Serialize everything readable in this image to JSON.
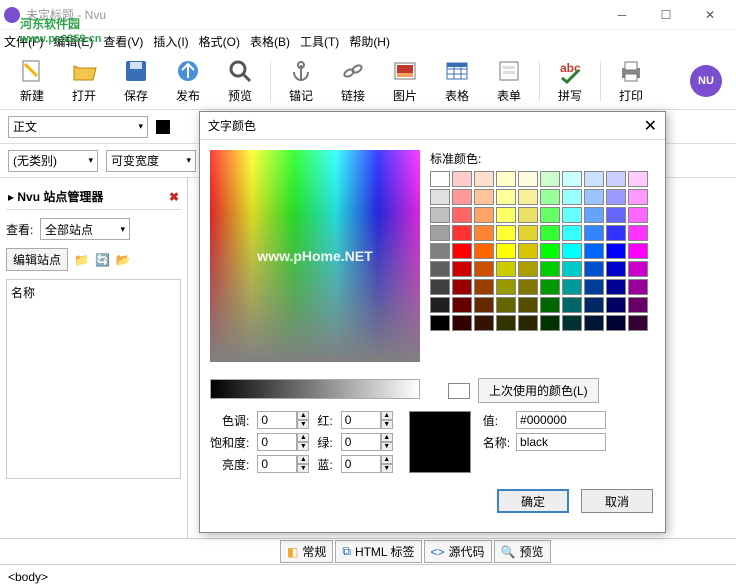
{
  "window": {
    "title": "未定标题 - Nvu"
  },
  "watermark": {
    "main": "河东软件园",
    "sub": "www.pc0359.cn"
  },
  "menu": {
    "file": "文件(F)",
    "edit": "编辑(E)",
    "view": "查看(V)",
    "insert": "插入(I)",
    "format": "格式(O)",
    "table": "表格(B)",
    "tools": "工具(T)",
    "help": "帮助(H)"
  },
  "toolbar": {
    "new": "新建",
    "open": "打开",
    "save": "保存",
    "publish": "发布",
    "preview": "预览",
    "anchor": "锚记",
    "link": "链接",
    "image": "图片",
    "table": "表格",
    "form": "表单",
    "spell": "拼写",
    "print": "打印"
  },
  "formatbar": {
    "style": "正文",
    "category": "(无类别)",
    "width": "可变宽度"
  },
  "sidepanel": {
    "title": "Nvu 站点管理器",
    "look": "查看:",
    "allsites": "全部站点",
    "editsite": "编辑站点",
    "name": "名称"
  },
  "tabs": {
    "normal": "常规",
    "htmltags": "HTML 标签",
    "source": "源代码",
    "preview": "预览"
  },
  "statusbar": {
    "path": "<body>"
  },
  "dialog": {
    "title": "文字颜色",
    "stdlabel": "标准颜色:",
    "lastused": "上次使用的颜色(L)",
    "hue": "色调:",
    "sat": "饱和度:",
    "lit": "亮度:",
    "red": "红:",
    "green": "绿:",
    "blue": "蓝:",
    "value": "值:",
    "name": "名称:",
    "hueV": "0",
    "satV": "0",
    "litV": "0",
    "redV": "0",
    "greenV": "0",
    "blueV": "0",
    "hex": "#000000",
    "nameV": "black",
    "ok": "确定",
    "cancel": "取消",
    "spectrum_wm": "www.pHome.NET"
  },
  "swatches": [
    "#ffffff",
    "#ffcccc",
    "#ffe0cc",
    "#ffffcc",
    "#fffde0",
    "#ccffcc",
    "#ccffff",
    "#cce0ff",
    "#ccccff",
    "#ffccff",
    "#e0e0e0",
    "#ff9999",
    "#ffc299",
    "#ffff99",
    "#f5f099",
    "#99ff99",
    "#99ffff",
    "#99c2ff",
    "#9999ff",
    "#ff99ff",
    "#c0c0c0",
    "#ff6666",
    "#ffa366",
    "#ffff66",
    "#ece066",
    "#66ff66",
    "#66ffff",
    "#66a3ff",
    "#6666ff",
    "#ff66ff",
    "#a0a0a0",
    "#ff3333",
    "#ff8533",
    "#ffff33",
    "#e2d333",
    "#33ff33",
    "#33ffff",
    "#3385ff",
    "#3333ff",
    "#ff33ff",
    "#808080",
    "#ff0000",
    "#ff6600",
    "#ffff00",
    "#d8c500",
    "#00ff00",
    "#00ffff",
    "#0066ff",
    "#0000ff",
    "#ff00ff",
    "#606060",
    "#cc0000",
    "#cc5200",
    "#cccc00",
    "#ad9e00",
    "#00cc00",
    "#00cccc",
    "#0052cc",
    "#0000cc",
    "#cc00cc",
    "#404040",
    "#990000",
    "#993d00",
    "#999900",
    "#827600",
    "#009900",
    "#009999",
    "#003d99",
    "#000099",
    "#990099",
    "#202020",
    "#660000",
    "#662900",
    "#666600",
    "#564f00",
    "#006600",
    "#006666",
    "#002966",
    "#000066",
    "#660066",
    "#000000",
    "#330000",
    "#331400",
    "#333300",
    "#2b2700",
    "#003300",
    "#003333",
    "#001433",
    "#000033",
    "#330033"
  ]
}
